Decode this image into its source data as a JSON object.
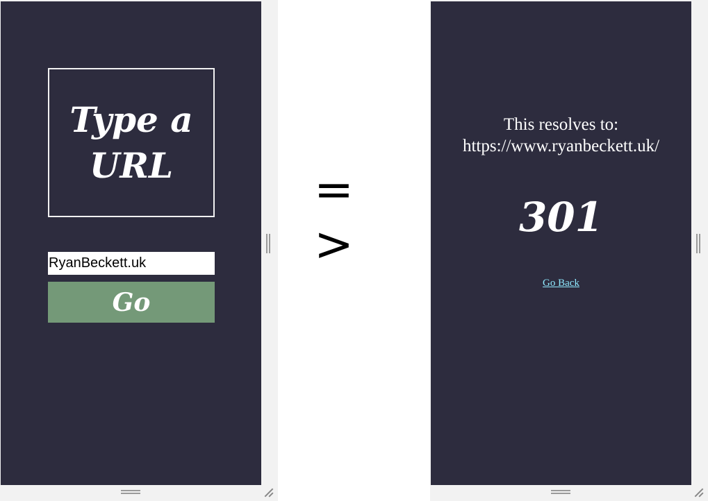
{
  "input_view": {
    "title": "Type a URL",
    "url_input_value": "RyanBeckett.uk",
    "go_button_label": "Go"
  },
  "arrow_label": "= >",
  "result_view": {
    "resolve_label": "This resolves to:",
    "resolved_url": "https://www.ryanbeckett.uk/",
    "status_code": "301",
    "go_back_label": "Go Back"
  },
  "colors": {
    "panel_background": "#2d2c3e",
    "go_button": "#749978",
    "link": "#8fe9ff",
    "frame": "#f2f2f2"
  }
}
